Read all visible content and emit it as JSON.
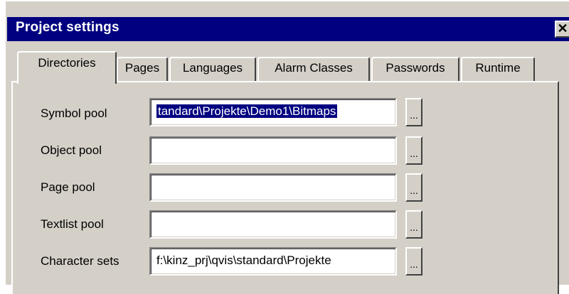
{
  "window": {
    "title": "Project settings",
    "close_glyph": "✕"
  },
  "tabs": [
    {
      "label": "Directories",
      "active": true
    },
    {
      "label": "Pages",
      "active": false
    },
    {
      "label": "Languages",
      "active": false
    },
    {
      "label": "Alarm Classes",
      "active": false
    },
    {
      "label": "Passwords",
      "active": false
    },
    {
      "label": "Runtime",
      "active": false
    }
  ],
  "directories": {
    "rows": [
      {
        "label": "Symbol pool",
        "value": "tandard\\Projekte\\Demo1\\Bitmaps",
        "selected": true,
        "browse": "..."
      },
      {
        "label": "Object pool",
        "value": "",
        "selected": false,
        "browse": "..."
      },
      {
        "label": "Page pool",
        "value": "",
        "selected": false,
        "browse": "..."
      },
      {
        "label": "Textlist pool",
        "value": "",
        "selected": false,
        "browse": "..."
      },
      {
        "label": "Character sets",
        "value": "f:\\kinz_prj\\qvis\\standard\\Projekte",
        "selected": false,
        "browse": "..."
      }
    ]
  },
  "colors": {
    "titlebar": "#000080",
    "face": "#d4d0c8",
    "selection": "#000080"
  }
}
